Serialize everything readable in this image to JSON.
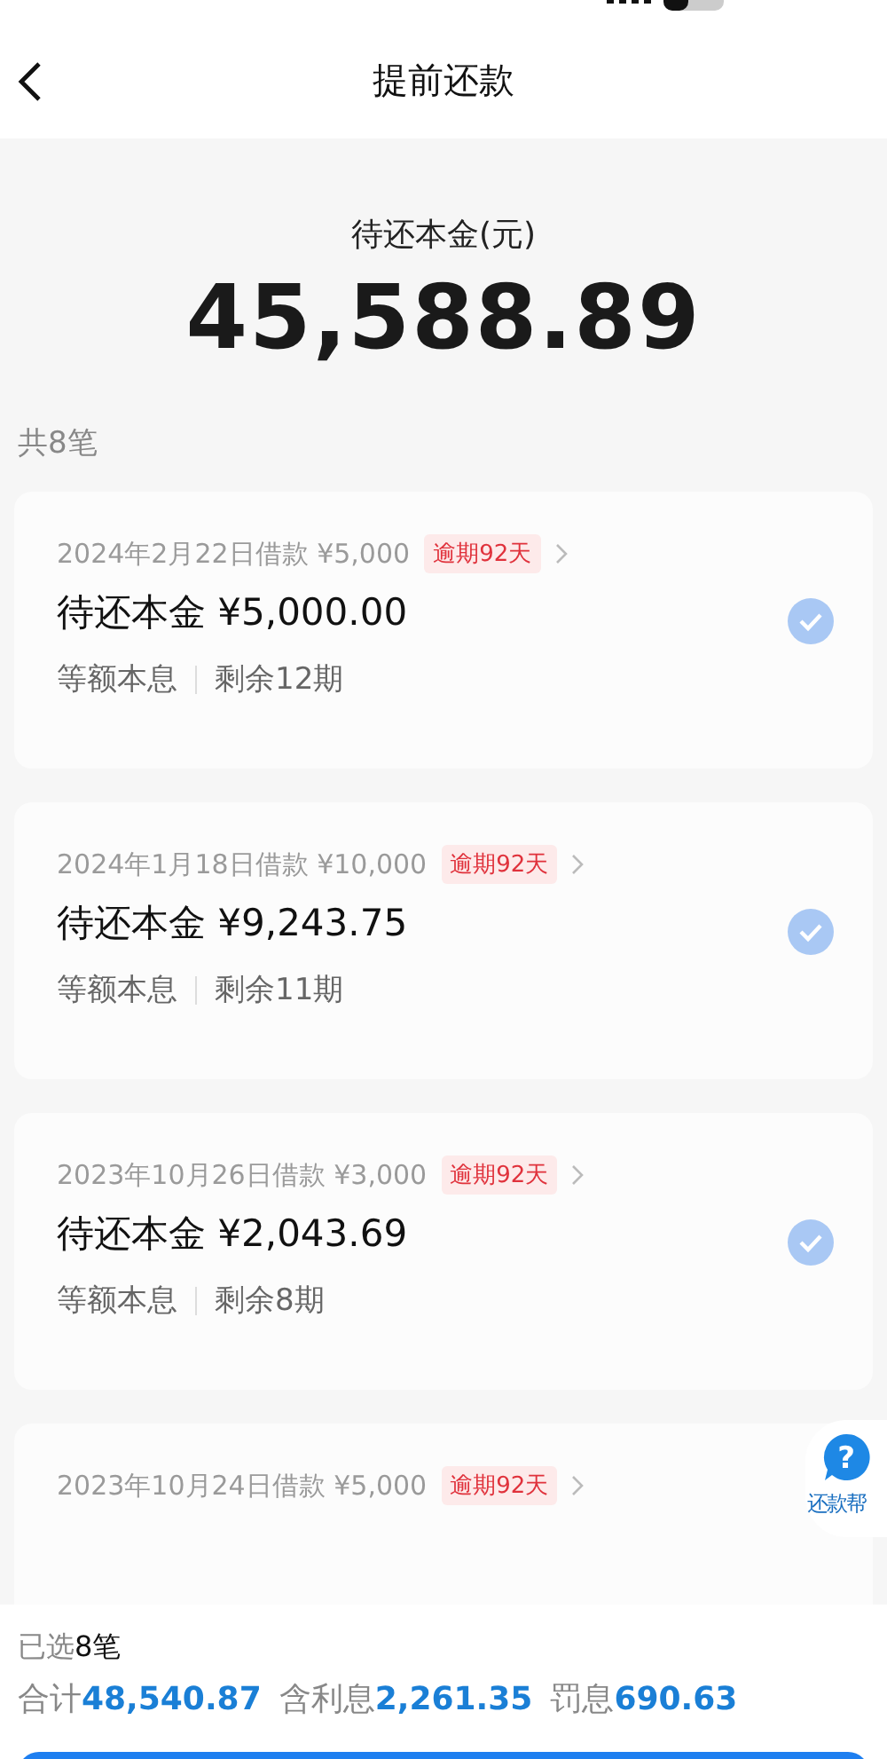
{
  "nav": {
    "title": "提前还款"
  },
  "summary": {
    "label": "待还本金(元)",
    "amount": "45,588.89"
  },
  "count": "共8笔",
  "loans": [
    {
      "date": "2024年2月22日借款 ¥5,000",
      "badge": "逾期92天",
      "principal": "待还本金 ¥5,000.00",
      "method": "等额本息",
      "remaining": "剩余12期",
      "selected": true
    },
    {
      "date": "2024年1月18日借款 ¥10,000",
      "badge": "逾期92天",
      "principal": "待还本金 ¥9,243.75",
      "method": "等额本息",
      "remaining": "剩余11期",
      "selected": true
    },
    {
      "date": "2023年10月26日借款 ¥3,000",
      "badge": "逾期92天",
      "principal": "待还本金 ¥2,043.69",
      "method": "等额本息",
      "remaining": "剩余8期",
      "selected": true
    },
    {
      "date": "2023年10月24日借款 ¥5,000",
      "badge": "逾期92天"
    }
  ],
  "help": {
    "mark": "?",
    "label": "还款帮"
  },
  "footer": {
    "selected_label": "已选",
    "selected_count": "8笔",
    "totals": [
      {
        "label": "合计",
        "value": "48,540.87"
      },
      {
        "label": "含利息",
        "value": "2,261.35"
      },
      {
        "label": "罚息",
        "value": "690.63"
      }
    ]
  }
}
